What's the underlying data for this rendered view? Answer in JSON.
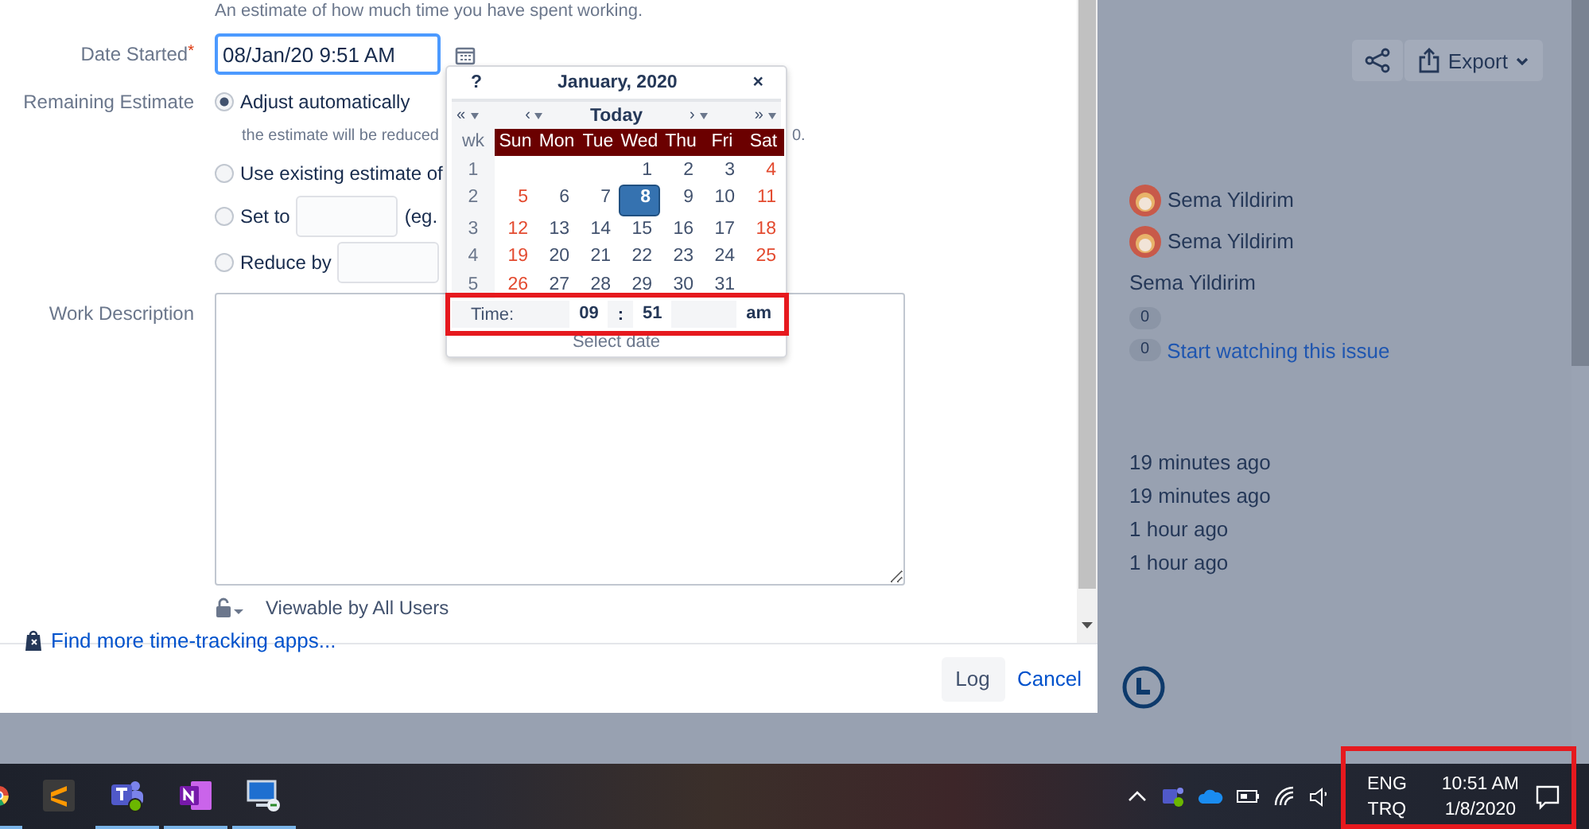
{
  "dialog": {
    "hint": "An estimate of how much time you have spent working.",
    "date_started": {
      "label": "Date Started",
      "required_mark": "*",
      "value": "08/Jan/20 9:51 AM"
    },
    "remaining_estimate": {
      "label": "Remaining Estimate",
      "options": [
        {
          "label": "Adjust automatically",
          "selected": true,
          "kind": "plain",
          "note": "the estimate will be reduced",
          "note_tail": "0."
        },
        {
          "label": "Use existing estimate of",
          "selected": false,
          "kind": "plain"
        },
        {
          "label": "Set to",
          "selected": false,
          "kind": "input",
          "suffix": "(eg."
        },
        {
          "label": "Reduce by",
          "selected": false,
          "kind": "input"
        }
      ]
    },
    "work_description": {
      "label": "Work Description"
    },
    "visibility": "Viewable by All Users",
    "apps_link": "Find more time-tracking apps...",
    "log": "Log",
    "cancel": "Cancel"
  },
  "calendar": {
    "help": "?",
    "title": "January, 2020",
    "close": "×",
    "nav": [
      "«",
      "‹",
      "Today",
      "›",
      "»"
    ],
    "week_label": "wk",
    "weekdays": [
      "Sun",
      "Mon",
      "Tue",
      "Wed",
      "Thu",
      "Fri",
      "Sat"
    ],
    "weeks": [
      {
        "wk": "1",
        "days": [
          {
            "day": "1",
            "selected": false
          },
          {
            "day": "2",
            "selected": false
          },
          {
            "day": "3",
            "selected": false
          },
          {
            "day": "4",
            "selected": false
          }
        ]
      },
      {
        "wk": "2",
        "days": [
          {
            "day": "5",
            "selected": false
          },
          {
            "day": "6",
            "selected": false
          },
          {
            "day": "7",
            "selected": false
          },
          {
            "day": "8",
            "selected": true
          },
          {
            "day": "9",
            "selected": false
          },
          {
            "day": "10",
            "selected": false
          },
          {
            "day": "11",
            "selected": false
          }
        ]
      },
      {
        "wk": "3",
        "days": [
          {
            "day": "12",
            "selected": false
          },
          {
            "day": "13",
            "selected": false
          },
          {
            "day": "14",
            "selected": false
          },
          {
            "day": "15",
            "selected": false
          },
          {
            "day": "16",
            "selected": false
          },
          {
            "day": "17",
            "selected": false
          },
          {
            "day": "18",
            "selected": false
          }
        ]
      },
      {
        "wk": "4",
        "days": [
          {
            "day": "19",
            "selected": false
          },
          {
            "day": "20",
            "selected": false
          },
          {
            "day": "21",
            "selected": false
          },
          {
            "day": "22",
            "selected": false
          },
          {
            "day": "23",
            "selected": false
          },
          {
            "day": "24",
            "selected": false
          },
          {
            "day": "25",
            "selected": false
          }
        ]
      },
      {
        "wk": "5",
        "days": [
          {
            "day": "26",
            "selected": false
          },
          {
            "day": "27",
            "selected": false
          },
          {
            "day": "28",
            "selected": false
          },
          {
            "day": "29",
            "selected": false
          },
          {
            "day": "30",
            "selected": false
          },
          {
            "day": "31",
            "selected": false
          }
        ]
      }
    ],
    "time": {
      "label": "Time:",
      "hour": "09",
      "separator": ":",
      "minute": "51",
      "period": "am",
      "highlighted": true
    },
    "footer": "Select date"
  },
  "side_panel": {
    "export": "Export",
    "people": [
      {
        "name": "Sema Yildirim",
        "avatar": true
      },
      {
        "name": "Sema Yildirim",
        "avatar": true
      },
      {
        "name": "Sema Yildirim",
        "avatar": false
      }
    ],
    "counters": [
      {
        "count": "0"
      },
      {
        "count": "0",
        "link": "Start watching this issue"
      }
    ],
    "times": [
      "19 minutes ago",
      "19 minutes ago",
      "1 hour ago",
      "1 hour ago"
    ]
  },
  "taskbar": {
    "apps": [
      {
        "kind": "chrome",
        "running": true
      },
      {
        "kind": "sublime",
        "running": false
      },
      {
        "kind": "teams",
        "running": true
      },
      {
        "kind": "onenote",
        "running": true
      },
      {
        "kind": "remote",
        "running": true
      }
    ],
    "language": [
      "ENG",
      "TRQ"
    ],
    "clock": {
      "time": "10:51 AM",
      "date": "1/8/2020",
      "highlighted": true
    }
  }
}
